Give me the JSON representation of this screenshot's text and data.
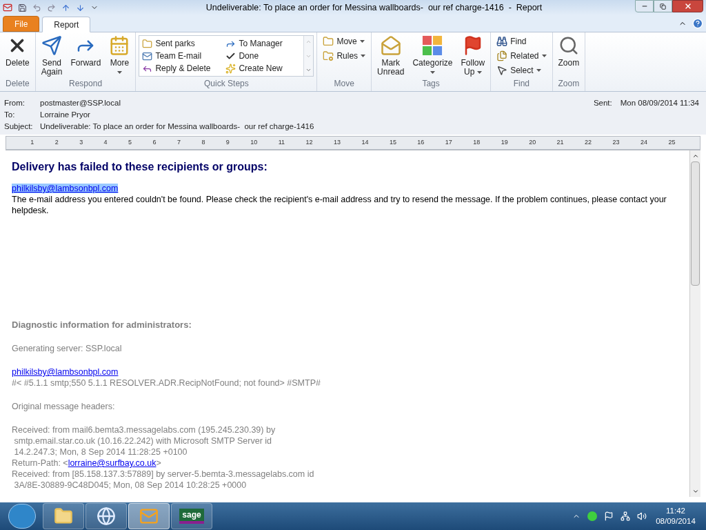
{
  "window": {
    "title": "Undeliverable: To place an order for Messina wallboards-  our ref charge-1416  -  Report"
  },
  "tabs": [
    {
      "label": "File",
      "kind": "file",
      "selected": false
    },
    {
      "label": "Report",
      "kind": "tab",
      "selected": true
    }
  ],
  "ribbon": [
    {
      "name": "Delete",
      "kind": "large",
      "buttons": [
        {
          "label": "Delete",
          "dropdown": false
        }
      ]
    },
    {
      "name": "Respond",
      "kind": "large",
      "buttons": [
        {
          "label": "Send Again",
          "dropdown": false
        },
        {
          "label": "Forward",
          "dropdown": false
        },
        {
          "label": "More",
          "dropdown": true
        }
      ]
    },
    {
      "name": "Quick Steps",
      "kind": "gallery",
      "buttons": [
        {
          "label": "Sent parks"
        },
        {
          "label": "To Manager"
        },
        {
          "label": "Team E-mail"
        },
        {
          "label": "Done"
        },
        {
          "label": "Reply & Delete"
        },
        {
          "label": "Create New"
        }
      ]
    },
    {
      "name": "Move",
      "kind": "small",
      "buttons": [
        {
          "label": "Move",
          "dropdown": true
        },
        {
          "label": "Rules",
          "dropdown": true
        }
      ]
    },
    {
      "name": "Tags",
      "kind": "large",
      "buttons": [
        {
          "label": "Mark Unread",
          "dropdown": false
        },
        {
          "label": "Categorize",
          "dropdown": true
        },
        {
          "label": "Follow Up",
          "dropdown": true
        }
      ]
    },
    {
      "name": "Find",
      "kind": "small",
      "buttons": [
        {
          "label": "Find",
          "dropdown": false
        },
        {
          "label": "Related",
          "dropdown": true
        },
        {
          "label": "Select",
          "dropdown": true
        }
      ]
    },
    {
      "name": "Zoom",
      "kind": "large",
      "buttons": [
        {
          "label": "Zoom",
          "dropdown": false
        }
      ]
    }
  ],
  "header": {
    "fields": [
      {
        "label": "From:",
        "value": "postmaster@SSP.local"
      },
      {
        "label": "To:",
        "value": "Lorraine Pryor"
      },
      {
        "label": "Subject:",
        "value": "Undeliverable: To place an order for Messina wallboards-  our ref charge-1416"
      }
    ],
    "sent_label": "Sent:",
    "sent_value": "Mon 08/09/2014 11:34"
  },
  "ruler": {
    "labels": [
      "1",
      "2",
      "3",
      "4",
      "5",
      "6",
      "7",
      "8",
      "9",
      "10",
      "11",
      "12",
      "13",
      "14",
      "15",
      "16",
      "17",
      "18",
      "19",
      "20",
      "21",
      "22",
      "23",
      "24",
      "25"
    ]
  },
  "body": [
    {
      "kind": "title",
      "parts": [
        {
          "text": "Delivery has failed to these recipients or groups:"
        }
      ]
    },
    {
      "kind": "recipient",
      "parts": [
        {
          "text": "philkilsby@lambsonbpl.com",
          "link": true,
          "selected": true
        }
      ]
    },
    {
      "kind": "notice",
      "parts": [
        {
          "text": "The e-mail address you entered couldn't be found. Please check the recipient's e-mail address and try to resend the message. If the problem continues, please contact your helpdesk."
        }
      ]
    },
    {
      "kind": "section",
      "parts": [
        {
          "text": "Diagnostic information for administrators:"
        }
      ]
    },
    {
      "kind": "para",
      "parts": [
        {
          "text": "Generating server: SSP.local"
        }
      ]
    },
    {
      "kind": "para",
      "parts": [
        {
          "text": "philkilsby@lambsonbpl.com",
          "link": true,
          "selected": false
        }
      ]
    },
    {
      "kind": "line",
      "parts": [
        {
          "text": "#< #5.1.1 smtp;550 5.1.1 RESOLVER.ADR.RecipNotFound; not found> #SMTP#"
        }
      ]
    },
    {
      "kind": "para",
      "parts": [
        {
          "text": "Original message headers:"
        }
      ]
    },
    {
      "kind": "para",
      "parts": [
        {
          "text": "Received: from mail6.bemta3.messagelabs.com (195.245.230.39) by"
        }
      ]
    },
    {
      "kind": "line",
      "parts": [
        {
          "text": " smtp.email.star.co.uk (10.16.22.242) with Microsoft SMTP Server id"
        }
      ]
    },
    {
      "kind": "line",
      "parts": [
        {
          "text": " 14.2.247.3; Mon, 8 Sep 2014 11:28:25 +0100"
        }
      ]
    },
    {
      "kind": "line",
      "parts": [
        {
          "text": "Return-Path: <"
        },
        {
          "text": "lorraine@surfbay.co.uk",
          "link": true,
          "selected": false
        },
        {
          "text": ">"
        }
      ]
    },
    {
      "kind": "line",
      "parts": [
        {
          "text": "Received: from [85.158.137.3:57889] by server-5.bemta-3.messagelabs.com id"
        }
      ]
    },
    {
      "kind": "line",
      "parts": [
        {
          "text": " 3A/8E-30889-9C48D045; Mon, 08 Sep 2014 10:28:25 +0000"
        }
      ]
    }
  ],
  "taskbar": {
    "apps": [
      {
        "kind": "folder",
        "selected": false
      },
      {
        "kind": "browser",
        "selected": false
      },
      {
        "kind": "mail",
        "selected": true
      },
      {
        "kind": "logo",
        "text": "sage",
        "selected": false
      }
    ],
    "time": "11:42",
    "date": "08/09/2014"
  }
}
